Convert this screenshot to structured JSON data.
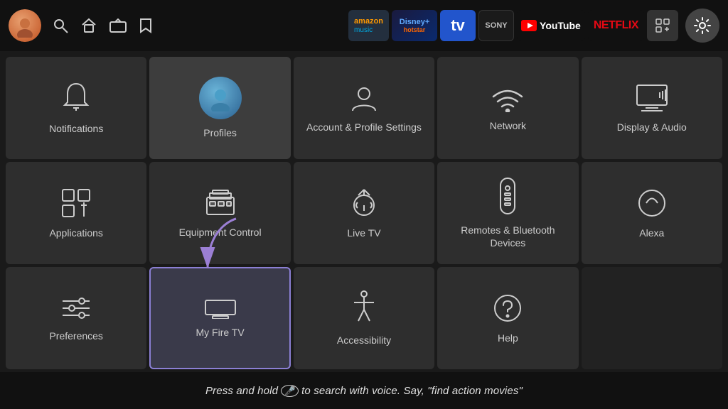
{
  "nav": {
    "avatar_emoji": "👤",
    "search_icon": "🔍",
    "home_icon": "⌂",
    "tv_icon": "📺",
    "bookmark_icon": "🔖",
    "settings_icon": "⚙️",
    "apps": [
      {
        "id": "amazon-music",
        "label": "amazon music",
        "sub": "music"
      },
      {
        "id": "disney",
        "label": "Disney+ Hotstar"
      },
      {
        "id": "tv",
        "label": "tv"
      },
      {
        "id": "sony",
        "label": "SONY"
      },
      {
        "id": "youtube",
        "label": "YouTube"
      },
      {
        "id": "netflix",
        "label": "NETFLIX"
      },
      {
        "id": "grid",
        "label": "⊞"
      }
    ]
  },
  "grid": {
    "cells": [
      {
        "id": "notifications",
        "label": "Notifications",
        "icon": "bell",
        "row": 1,
        "col": 1
      },
      {
        "id": "profiles",
        "label": "Profiles",
        "icon": "profile",
        "row": 1,
        "col": 2
      },
      {
        "id": "account",
        "label": "Account & Profile Settings",
        "icon": "person",
        "row": 1,
        "col": 3
      },
      {
        "id": "network",
        "label": "Network",
        "icon": "wifi",
        "row": 1,
        "col": 4
      },
      {
        "id": "display-audio",
        "label": "Display & Audio",
        "icon": "display",
        "row": 1,
        "col": 5
      },
      {
        "id": "applications",
        "label": "Applications",
        "icon": "apps",
        "row": 2,
        "col": 1
      },
      {
        "id": "equipment-control",
        "label": "Equipment Control",
        "icon": "equipment",
        "row": 2,
        "col": 2
      },
      {
        "id": "live-tv",
        "label": "Live TV",
        "icon": "antenna",
        "row": 2,
        "col": 3
      },
      {
        "id": "remotes",
        "label": "Remotes & Bluetooth Devices",
        "icon": "remote",
        "row": 2,
        "col": 4
      },
      {
        "id": "alexa",
        "label": "Alexa",
        "icon": "alexa",
        "row": 2,
        "col": 5
      },
      {
        "id": "preferences",
        "label": "Preferences",
        "icon": "sliders",
        "row": 3,
        "col": 1
      },
      {
        "id": "my-fire-tv",
        "label": "My Fire TV",
        "icon": "firetv",
        "row": 3,
        "col": 2
      },
      {
        "id": "accessibility",
        "label": "Accessibility",
        "icon": "accessibility",
        "row": 3,
        "col": 3
      },
      {
        "id": "help",
        "label": "Help",
        "icon": "help",
        "row": 3,
        "col": 4
      }
    ]
  },
  "bottom": {
    "text": "Press and hold ",
    "mic": "🎤",
    "text2": " to search with voice. Say, \"find action movies\""
  }
}
